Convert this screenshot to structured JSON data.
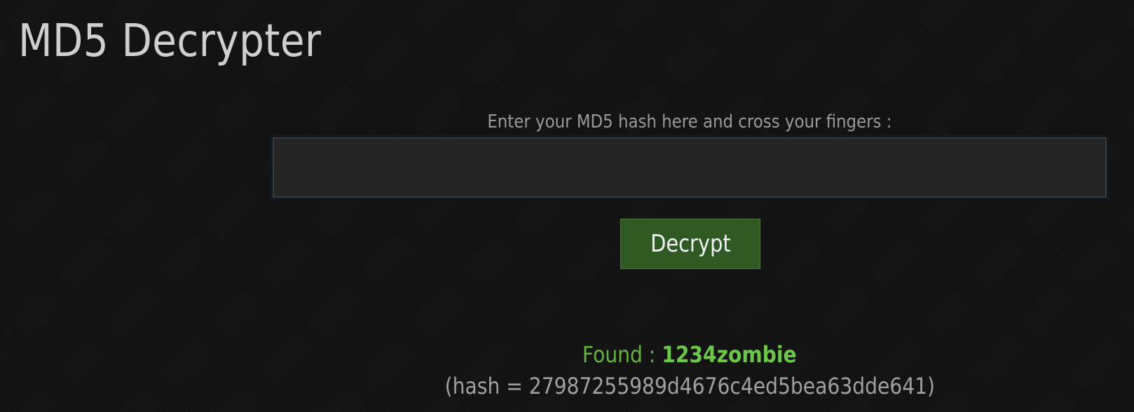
{
  "header": {
    "title": "MD5 Decrypter"
  },
  "form": {
    "label": "Enter your MD5 hash here and cross your fingers :",
    "input_value": "",
    "button_label": "Decrypt"
  },
  "result": {
    "found_prefix": "Found : ",
    "found_value": "1234zombie",
    "hash_line": "(hash = 27987255989d4676c4ed5bea63dde641)"
  },
  "colors": {
    "background": "#141414",
    "button": "#2f5a24",
    "found": "#64b640"
  }
}
